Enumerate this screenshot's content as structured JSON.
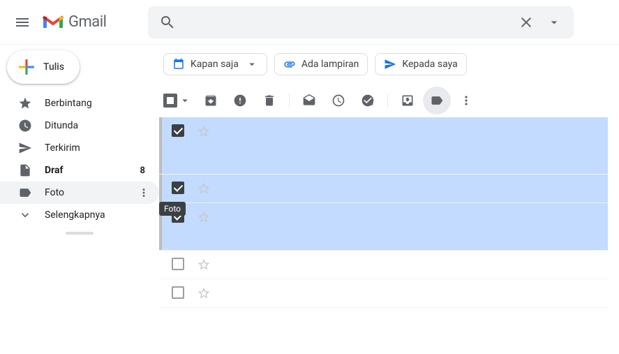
{
  "app": {
    "name": "Gmail"
  },
  "compose": {
    "label": "Tulis"
  },
  "sidebar": {
    "items": [
      {
        "icon": "star",
        "label": "Berbintang"
      },
      {
        "icon": "clock",
        "label": "Ditunda"
      },
      {
        "icon": "send",
        "label": "Terkirim"
      },
      {
        "icon": "file",
        "label": "Draf",
        "count": "8",
        "bold": true
      },
      {
        "icon": "label",
        "label": "Foto",
        "active": true,
        "more": true
      },
      {
        "icon": "chevron-down",
        "label": "Selengkapnya"
      }
    ]
  },
  "tooltip": {
    "text": "Foto"
  },
  "filters": [
    {
      "icon": "calendar",
      "label": "Kapan saja",
      "caret": true,
      "color": "#1a73e8"
    },
    {
      "icon": "attachment",
      "label": "Ada lampiran",
      "color": "#1a73e8"
    },
    {
      "icon": "send-blue",
      "label": "Kepada saya",
      "color": "#1a73e8"
    }
  ],
  "mails": [
    {
      "selected": true,
      "tall": true
    },
    {
      "selected": true
    },
    {
      "selected": true,
      "tall2": true
    },
    {
      "selected": false
    },
    {
      "selected": false
    }
  ]
}
